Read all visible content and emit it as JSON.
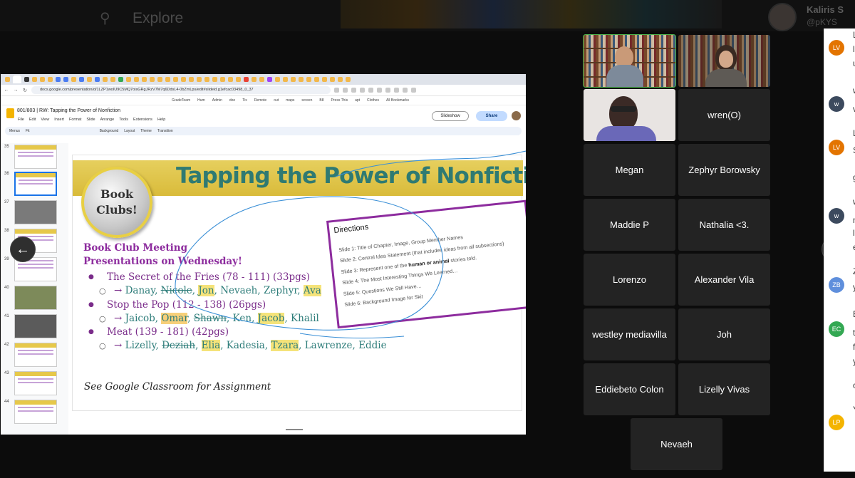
{
  "background": {
    "explore_label": "Explore",
    "profile_name": "Kaliris S",
    "profile_handle": "@pKYS"
  },
  "browser": {
    "url": "docs.google.com/presentation/d/1LZP1woIU9C5MQ7oisGRgJRzV7M7q6DdsL4-0bZmLps/edit#slideid.g1efcac03498_0_37",
    "bookmarks": [
      "GradeTeam",
      "Hum",
      "Admin",
      "doe",
      "Tix",
      "Remote",
      "out",
      "maps",
      "screen",
      "B8",
      "Press This",
      "apt",
      "Clothes",
      "All Bookmarks"
    ],
    "doc_title": "801/803 | RW: Tapping the Power of Nonfiction",
    "menu": [
      "File",
      "Edit",
      "View",
      "Insert",
      "Format",
      "Slide",
      "Arrange",
      "Tools",
      "Extensions",
      "Help"
    ],
    "slideshow_label": "Slideshow",
    "share_label": "Share",
    "toolbar": {
      "search": "Menus",
      "zoom": "Fit",
      "background": "Background",
      "layout": "Layout",
      "theme": "Theme",
      "transition": "Transition"
    },
    "thumb_numbers": [
      "35",
      "36",
      "37",
      "38",
      "39",
      "40",
      "41",
      "42",
      "43",
      "44"
    ]
  },
  "slide": {
    "title": "Tapping the Power of Nonfiction",
    "badge_line1": "Book",
    "badge_line2": "Clubs!",
    "meeting_line1": "Book Club Meeting",
    "meeting_line2": "Presentations on Wednesday!",
    "books": [
      {
        "title": "The Secret of the Fries (78 - 111) (33pgs)",
        "arrow": "→",
        "names": [
          "Danay",
          "Nicole",
          "Jon",
          "Nevaeh",
          "Zephyr",
          "Ava"
        ]
      },
      {
        "title": "Stop the Pop (112 - 138) (26pgs)",
        "arrow": "→",
        "names": [
          "Jaicob",
          "Omar",
          "Shawn",
          "Ken",
          "Jacob",
          "Khalil"
        ]
      },
      {
        "title": "Meat (139 - 181) (42pgs)",
        "arrow": "→",
        "names": [
          "Lizelly",
          "Deziah",
          "Elia",
          "Kadesia",
          "Tzara",
          "Lawrenze",
          "Eddie"
        ]
      }
    ],
    "footer": "See Google Classroom for Assignment",
    "directions": {
      "title": "Directions",
      "items": [
        "Slide 1: Title of Chapter, Image, Group Member Names",
        "Slide 2: Central Idea Statement (that includes ideas from all subsections)",
        "Slide 3: Represent one of the ",
        "Slide 4: The Most Interesting Things We Learned…",
        "Slide 5: Questions We Still Have…",
        "Slide 6: Background Image for Skit"
      ],
      "item3_bold": "human or animal",
      "item3_tail": " stories told."
    }
  },
  "participants": {
    "names": [
      "wren(O)",
      "Megan",
      "Zephyr Borowsky",
      "Maddie P",
      "Nathalia <3.",
      "Lorenzo",
      "Alexander Vila",
      "westley mediavilla",
      "Joh",
      "Eddiebeto Colon",
      "Lizelly Vivas",
      "Nevaeh"
    ]
  },
  "chat": {
    "avatars": [
      {
        "initials": "LV",
        "color": "#e37400"
      },
      {
        "initials": "w",
        "color": "#3c4a5e"
      },
      {
        "initials": "LV",
        "color": "#e37400"
      },
      {
        "initials": "w",
        "color": "#3c4a5e"
      },
      {
        "initials": "ZB",
        "color": "#5f8fdc"
      },
      {
        "initials": "EC",
        "color": "#34a853"
      },
      {
        "initials": "LP",
        "color": "#f4b400"
      }
    ],
    "snippets": [
      "L",
      "l",
      "u",
      "w",
      "v",
      "L",
      "S",
      "g",
      "w",
      "n",
      "l",
      "e",
      "Z",
      "y",
      "E",
      "t",
      "f",
      "y",
      "c",
      "Y"
    ]
  },
  "nav": {
    "prev_glyph": "←",
    "next_glyph": "→"
  }
}
